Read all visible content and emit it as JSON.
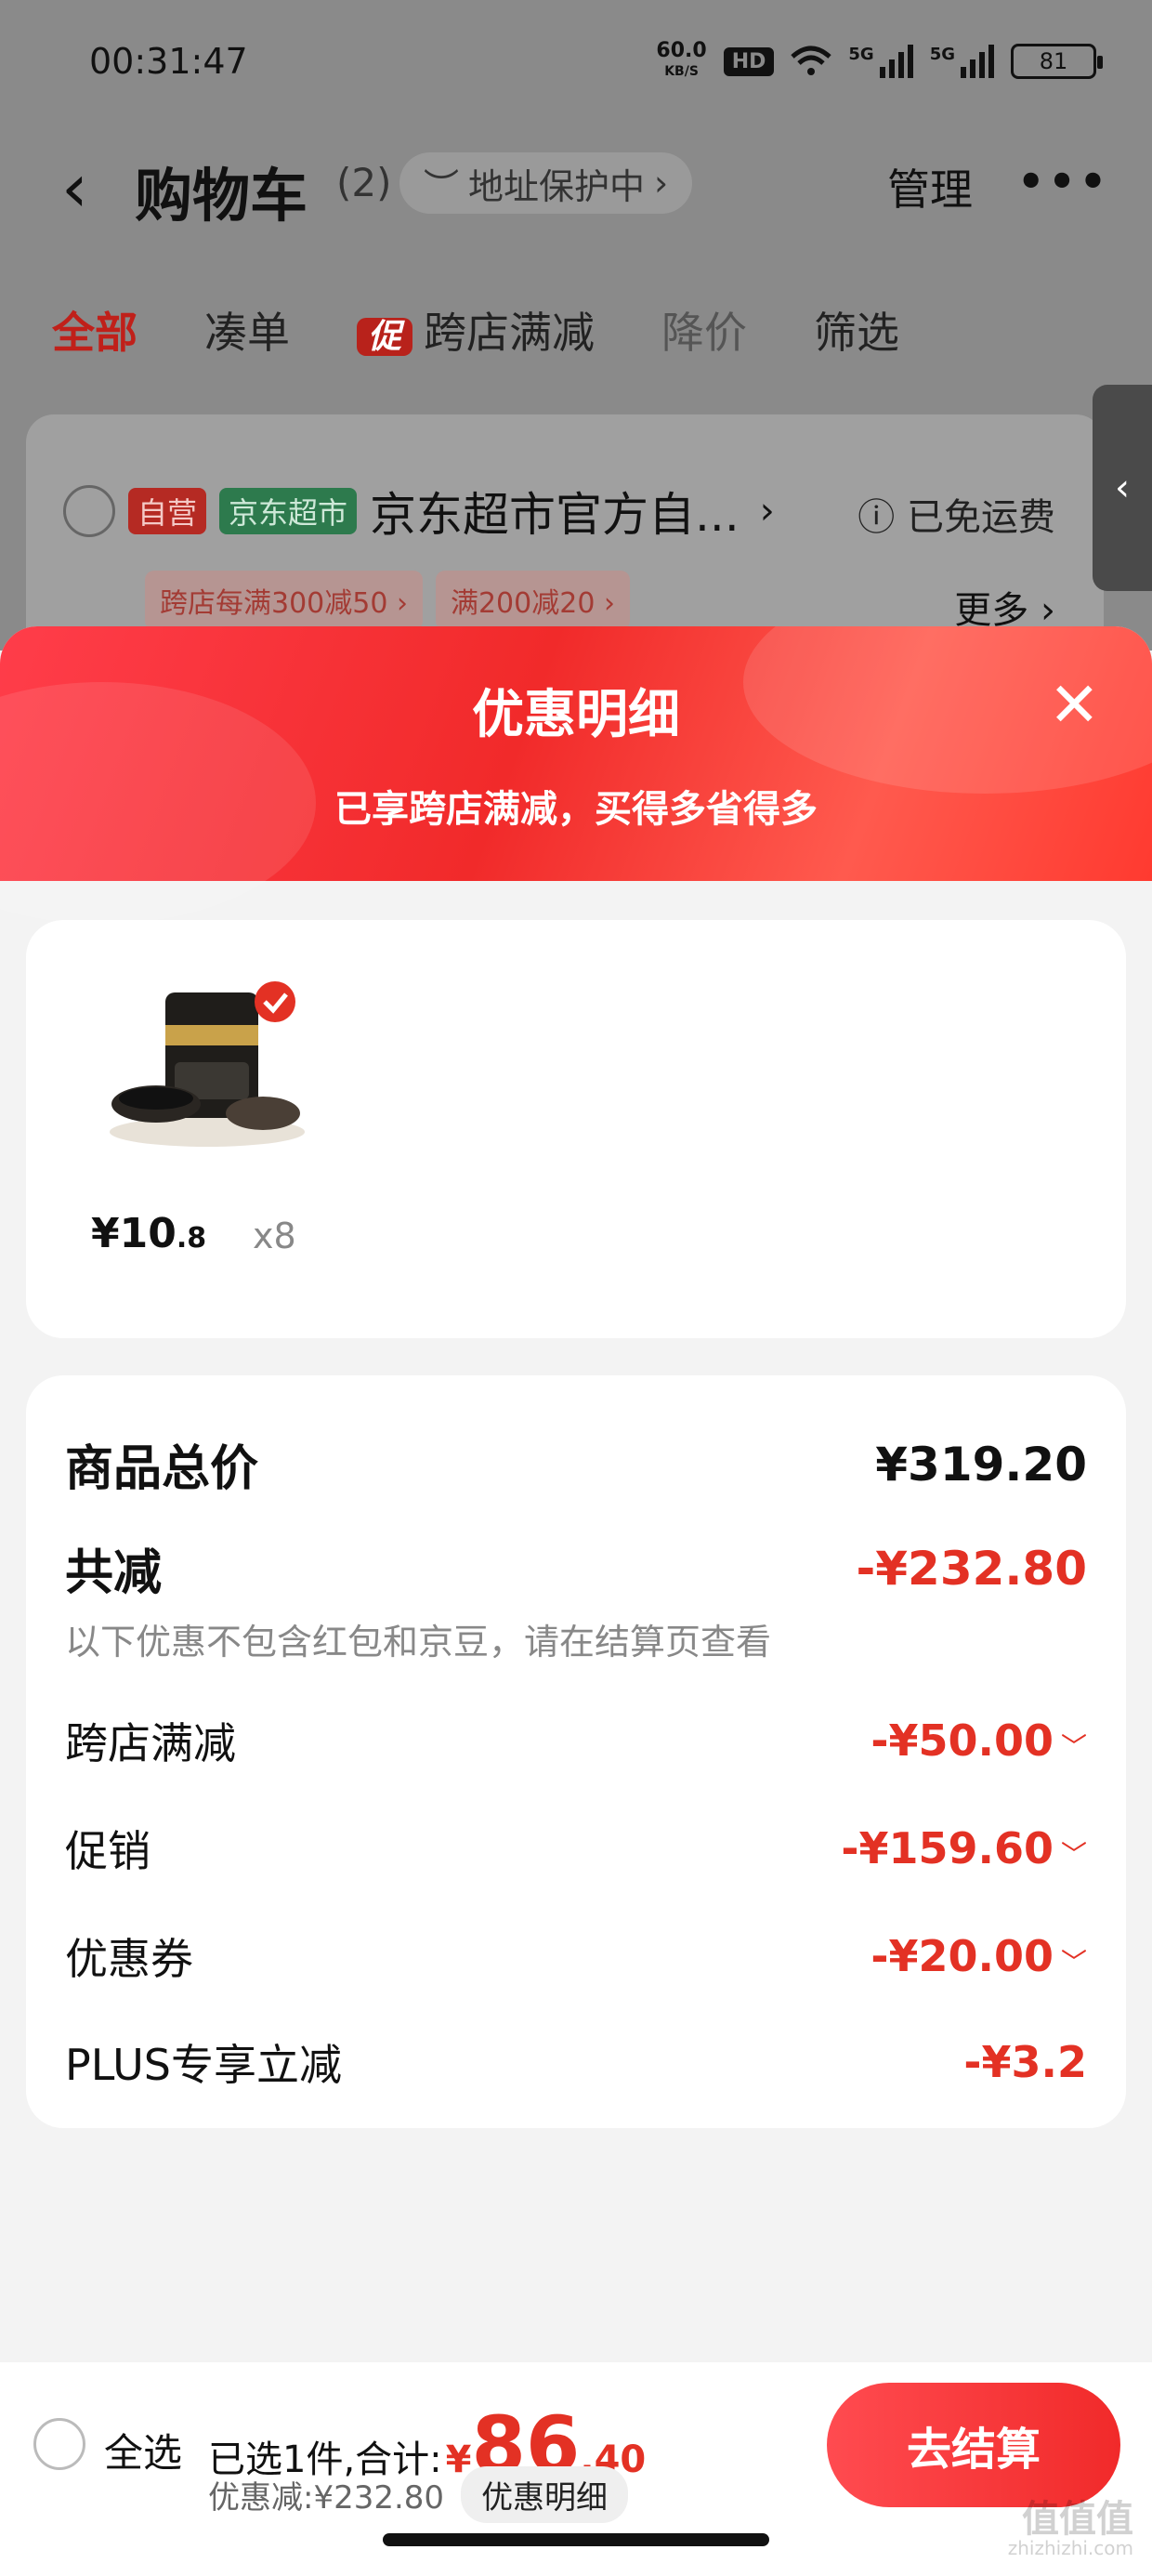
{
  "status_bar": {
    "time": "00:31:47",
    "net_rate": "60.0",
    "net_unit": "KB/S",
    "hd": "HD",
    "sig1": "5G",
    "sig2": "5G",
    "battery": "81"
  },
  "header": {
    "back": "‹",
    "title": "购物车",
    "count": "(2)",
    "address_protect": "地址保护中",
    "manage": "管理",
    "more": "•••"
  },
  "tabs": {
    "all": "全部",
    "add_on": "凑单",
    "promo_tag": "促",
    "cross_store": "跨店满减",
    "price_drop": "降价",
    "filter": "筛选"
  },
  "store": {
    "tag_self": "自营",
    "tag_super": "京东超市",
    "name": "京东超市官方自...",
    "free_shipping": "已免运费",
    "coupons": [
      "跨店每满300减50 ›",
      "满200减20 ›"
    ],
    "more": "更多 ›"
  },
  "sheet": {
    "title": "优惠明细",
    "subtitle": "已享跨店满减，买得多省得多",
    "close": "✕"
  },
  "item": {
    "price_int": "¥10",
    "price_dec": ".8",
    "qty": "x8"
  },
  "summary": {
    "total_label": "商品总价",
    "total_value": "¥319.20",
    "reduce_label": "共减",
    "reduce_value": "-¥232.80",
    "note": "以下优惠不包含红包和京豆，请在结算页查看",
    "lines": [
      {
        "label": "跨店满减",
        "value": "-¥50.00"
      },
      {
        "label": "促销",
        "value": "-¥159.60"
      },
      {
        "label": "优惠券",
        "value": "-¥20.00"
      },
      {
        "label": "PLUS专享立减",
        "value": "-¥3.2"
      }
    ]
  },
  "bottom": {
    "select_all": "全选",
    "selected_text": "已选1件,合计:",
    "yen": "¥",
    "total_int": "86",
    "total_dec": ".40",
    "discount_text": "优惠减:¥232.80",
    "discount_detail": "优惠明细",
    "checkout": "去结算"
  },
  "watermark": {
    "main": "值值值",
    "sub": "zhizhizhi.com"
  }
}
